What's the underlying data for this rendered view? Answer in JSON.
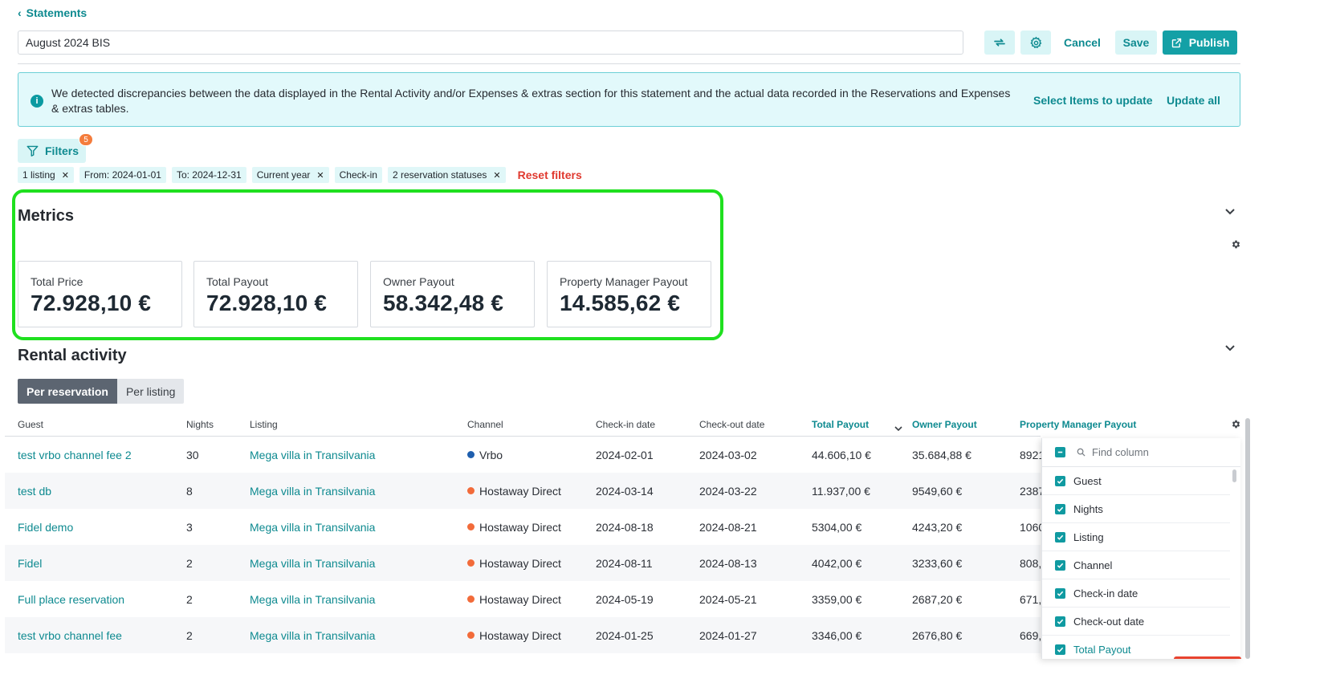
{
  "header": {
    "back_label": "Statements",
    "title_value": "August 2024 BIS",
    "cancel_label": "Cancel",
    "save_label": "Save",
    "publish_label": "Publish"
  },
  "alert": {
    "message": "We detected discrepancies between the data displayed in the Rental Activity and/or Expenses & extras section for this statement and the actual data recorded in the Reservations and Expenses & extras tables.",
    "select_items_label": "Select Items to update",
    "update_all_label": "Update all"
  },
  "filters": {
    "label": "Filters",
    "count": "5",
    "chips": [
      {
        "label": "1 listing",
        "removable": true
      },
      {
        "label": "From: 2024-01-01",
        "removable": false
      },
      {
        "label": "To: 2024-12-31",
        "removable": false
      },
      {
        "label": "Current year",
        "removable": true
      },
      {
        "label": "Check-in",
        "removable": false
      },
      {
        "label": "2 reservation statuses",
        "removable": true
      }
    ],
    "reset_label": "Reset filters"
  },
  "metrics": {
    "title": "Metrics",
    "cards": [
      {
        "label": "Total Price",
        "value": "72.928,10 €"
      },
      {
        "label": "Total Payout",
        "value": "72.928,10 €"
      },
      {
        "label": "Owner Payout",
        "value": "58.342,48 €"
      },
      {
        "label": "Property Manager Payout",
        "value": "14.585,62 €"
      }
    ]
  },
  "rental": {
    "title": "Rental activity",
    "tabs": [
      "Per reservation",
      "Per listing"
    ],
    "columns": {
      "guest": "Guest",
      "nights": "Nights",
      "listing": "Listing",
      "channel": "Channel",
      "checkin": "Check-in date",
      "checkout": "Check-out date",
      "total_payout": "Total Payout",
      "owner_payout": "Owner Payout",
      "pm_payout": "Property Manager Payout"
    },
    "rows": [
      {
        "guest": "test vrbo channel fee 2",
        "nights": "30",
        "listing": "Mega villa in Transilvania",
        "channel": "Vrbo",
        "channel_color": "#1f5fae",
        "checkin": "2024-02-01",
        "checkout": "2024-03-02",
        "total": "44.606,10 €",
        "owner": "35.684,88 €",
        "pm": "8921"
      },
      {
        "guest": "test db",
        "nights": "8",
        "listing": "Mega villa in Transilvania",
        "channel": "Hostaway Direct",
        "channel_color": "#f26b3a",
        "checkin": "2024-03-14",
        "checkout": "2024-03-22",
        "total": "11.937,00 €",
        "owner": "9549,60 €",
        "pm": "2387"
      },
      {
        "guest": "Fidel demo",
        "nights": "3",
        "listing": "Mega villa in Transilvania",
        "channel": "Hostaway Direct",
        "channel_color": "#f26b3a",
        "checkin": "2024-08-18",
        "checkout": "2024-08-21",
        "total": "5304,00 €",
        "owner": "4243,20 €",
        "pm": "1060"
      },
      {
        "guest": "Fidel",
        "nights": "2",
        "listing": "Mega villa in Transilvania",
        "channel": "Hostaway Direct",
        "channel_color": "#f26b3a",
        "checkin": "2024-08-11",
        "checkout": "2024-08-13",
        "total": "4042,00 €",
        "owner": "3233,60 €",
        "pm": "808,"
      },
      {
        "guest": "Full place reservation",
        "nights": "2",
        "listing": "Mega villa in Transilvania",
        "channel": "Hostaway Direct",
        "channel_color": "#f26b3a",
        "checkin": "2024-05-19",
        "checkout": "2024-05-21",
        "total": "3359,00 €",
        "owner": "2687,20 €",
        "pm": "671,"
      },
      {
        "guest": "test vrbo channel fee",
        "nights": "2",
        "listing": "Mega villa in Transilvania",
        "channel": "Hostaway Direct",
        "channel_color": "#f26b3a",
        "checkin": "2024-01-25",
        "checkout": "2024-01-27",
        "total": "3346,00 €",
        "owner": "2676,80 €",
        "pm": "669,"
      }
    ]
  },
  "column_panel": {
    "search_placeholder": "Find column",
    "items": [
      {
        "label": "Guest",
        "checked": true
      },
      {
        "label": "Nights",
        "checked": true
      },
      {
        "label": "Listing",
        "checked": true
      },
      {
        "label": "Channel",
        "checked": true
      },
      {
        "label": "Check-in date",
        "checked": true
      },
      {
        "label": "Check-out date",
        "checked": true
      },
      {
        "label": "Total Payout",
        "checked": true
      }
    ]
  },
  "colors": {
    "teal": "#14a0a6",
    "highlight_green": "#1fe01f",
    "reset_red": "#e0392f",
    "badge_orange": "#f47c3c"
  },
  "icons": [
    "chevron-left-icon",
    "sync-icon",
    "gear-icon",
    "publish-icon",
    "info-icon",
    "filter-icon",
    "close-icon",
    "chevron-down-icon",
    "sort-icon",
    "search-icon",
    "checkbox-icon"
  ]
}
